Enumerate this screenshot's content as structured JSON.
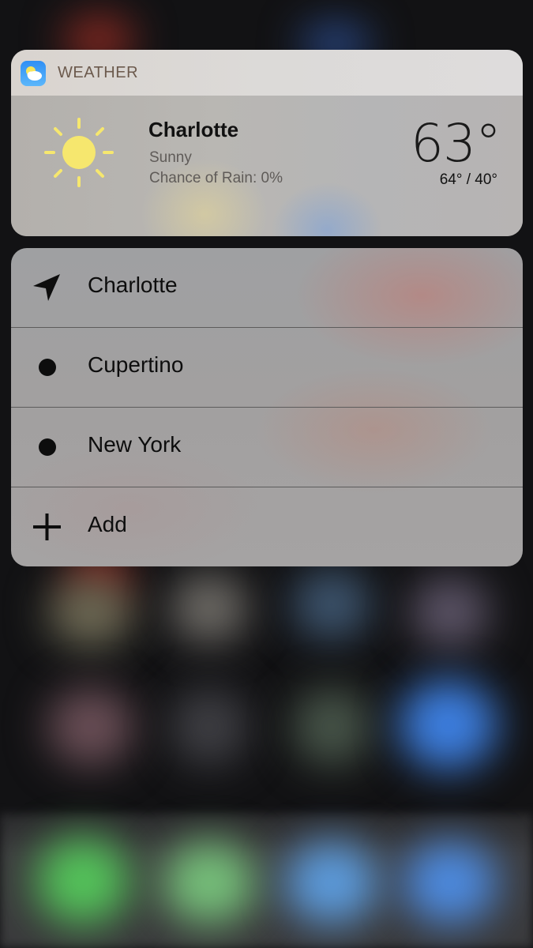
{
  "widget": {
    "app_name": "WEATHER",
    "app_icon": "weather-app-icon",
    "city": "Charlotte",
    "condition": "Sunny",
    "rain_chance": "Chance of Rain: 0%",
    "temperature": "63°",
    "high_low": "64° / 40°",
    "condition_icon": "sun-icon"
  },
  "menu": {
    "items": [
      {
        "label": "Charlotte",
        "icon": "location-arrow-icon"
      },
      {
        "label": "Cupertino",
        "icon": "bullet-icon"
      },
      {
        "label": "New York",
        "icon": "bullet-icon"
      },
      {
        "label": "Add",
        "icon": "plus-icon"
      }
    ]
  },
  "colors": {
    "sun": "#f6e76e",
    "app_icon_top": "#2f8ff5",
    "header_text": "#6c5a4d"
  }
}
